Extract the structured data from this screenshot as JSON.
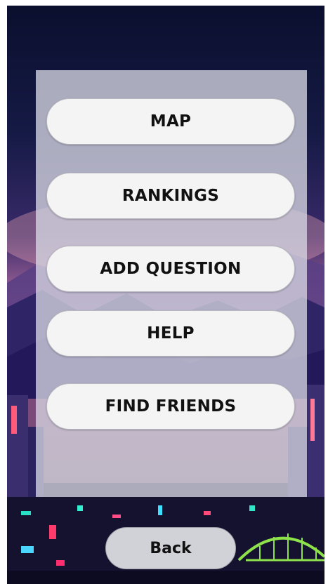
{
  "menu": {
    "items": [
      {
        "label": "MAP"
      },
      {
        "label": "RANKINGS"
      },
      {
        "label": "ADD QUESTION"
      },
      {
        "label": "HELP"
      },
      {
        "label": "FIND FRIENDS"
      }
    ]
  },
  "footer": {
    "back_label": "Back"
  }
}
